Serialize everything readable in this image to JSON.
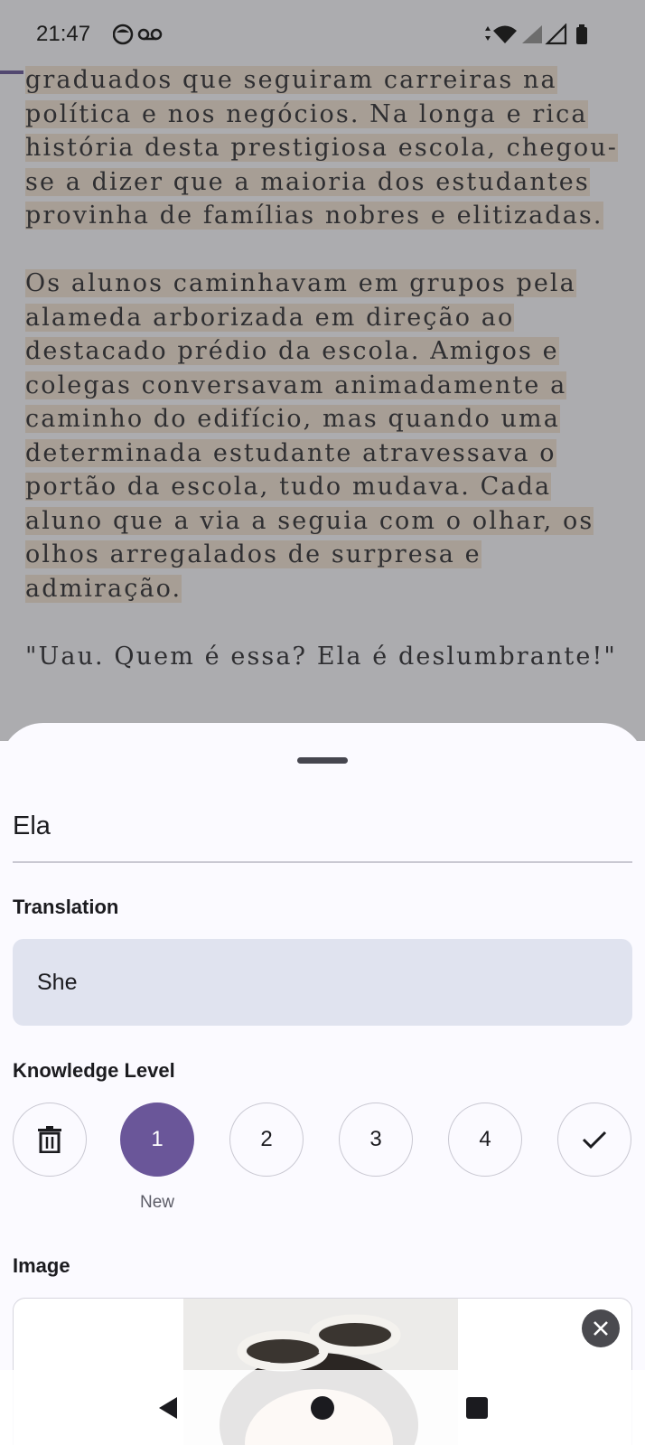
{
  "status_bar": {
    "time": "21:47",
    "left_icons": [
      "media-icon",
      "voicemail-icon"
    ],
    "right_icons": [
      "data-arrows-icon",
      "wifi-icon",
      "signal-icon",
      "signal-empty-icon",
      "battery-icon"
    ]
  },
  "reader": {
    "paragraphs": [
      "graduados que seguiram carreiras na política e nos negócios. Na longa e rica história desta prestigiosa escola, chegou-se a dizer que a maioria dos estudantes provinha de famílias nobres e elitizadas.",
      "Os alunos caminhavam em grupos pela alameda arborizada em direção ao destacado prédio da escola. Amigos e colegas conversavam animadamente a caminho do edifício, mas quando uma determinada estudante atravessava o portão da escola, tudo mudava. Cada aluno que a via a seguia com o olhar, os olhos arregalados de surpresa e admiração.",
      "\"Uau. Quem é essa? Ela é deslumbrante!\""
    ]
  },
  "sheet": {
    "word": "Ela",
    "translation_label": "Translation",
    "translation_value": "She",
    "knowledge_label": "Knowledge Level",
    "levels": [
      {
        "id": "delete",
        "icon": "trash-icon"
      },
      {
        "id": "1",
        "label": "1",
        "active": true
      },
      {
        "id": "2",
        "label": "2"
      },
      {
        "id": "3",
        "label": "3"
      },
      {
        "id": "4",
        "label": "4"
      },
      {
        "id": "known",
        "icon": "check-icon"
      }
    ],
    "active_level_caption": "New",
    "image_label": "Image"
  },
  "colors": {
    "accent": "#6a5699",
    "highlight": "#f6e6cf",
    "sheet_bg": "#fbfaff",
    "field_bg": "#e0e3ef"
  },
  "nav": {
    "buttons": [
      "back-icon",
      "home-icon",
      "recents-icon"
    ]
  }
}
